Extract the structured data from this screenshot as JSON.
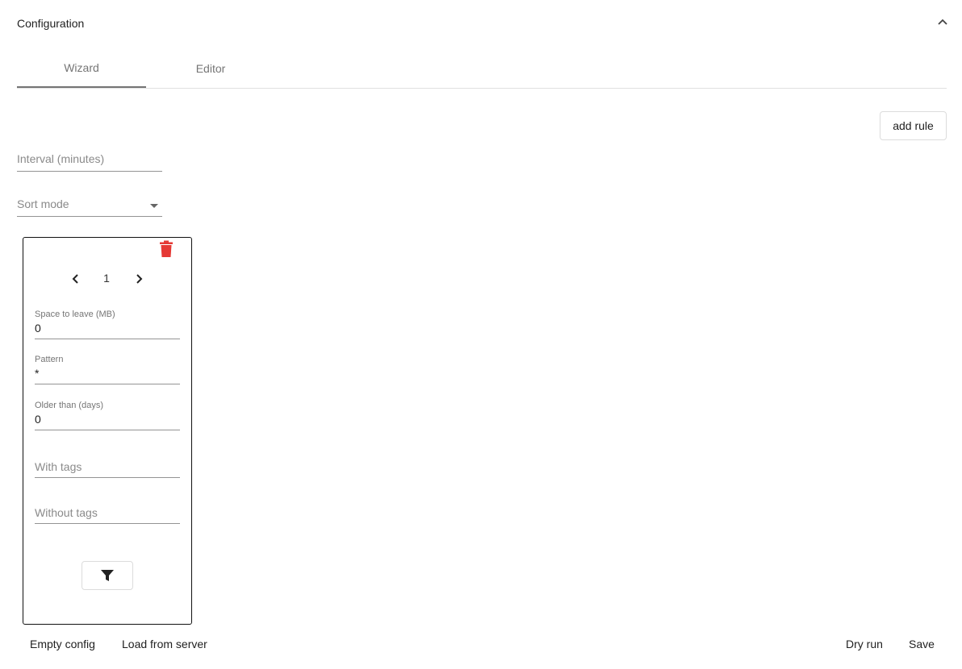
{
  "header": {
    "title": "Configuration"
  },
  "tabs": [
    {
      "label": "Wizard",
      "active": true
    },
    {
      "label": "Editor",
      "active": false
    }
  ],
  "toolbar": {
    "add_rule_label": "add rule"
  },
  "settings": {
    "interval_placeholder": "Interval (minutes)",
    "sort_mode_placeholder": "Sort mode"
  },
  "rule_card": {
    "page_number": "1",
    "space_to_leave": {
      "label": "Space to leave (MB)",
      "value": "0"
    },
    "pattern": {
      "label": "Pattern",
      "value": "*"
    },
    "older_than": {
      "label": "Older than (days)",
      "value": "0"
    },
    "with_tags_placeholder": "With tags",
    "without_tags_placeholder": "Without tags",
    "delete_color": "#e53935"
  },
  "footer": {
    "empty_config_label": "Empty config",
    "load_from_server_label": "Load from server",
    "dry_run_label": "Dry run",
    "save_label": "Save"
  }
}
